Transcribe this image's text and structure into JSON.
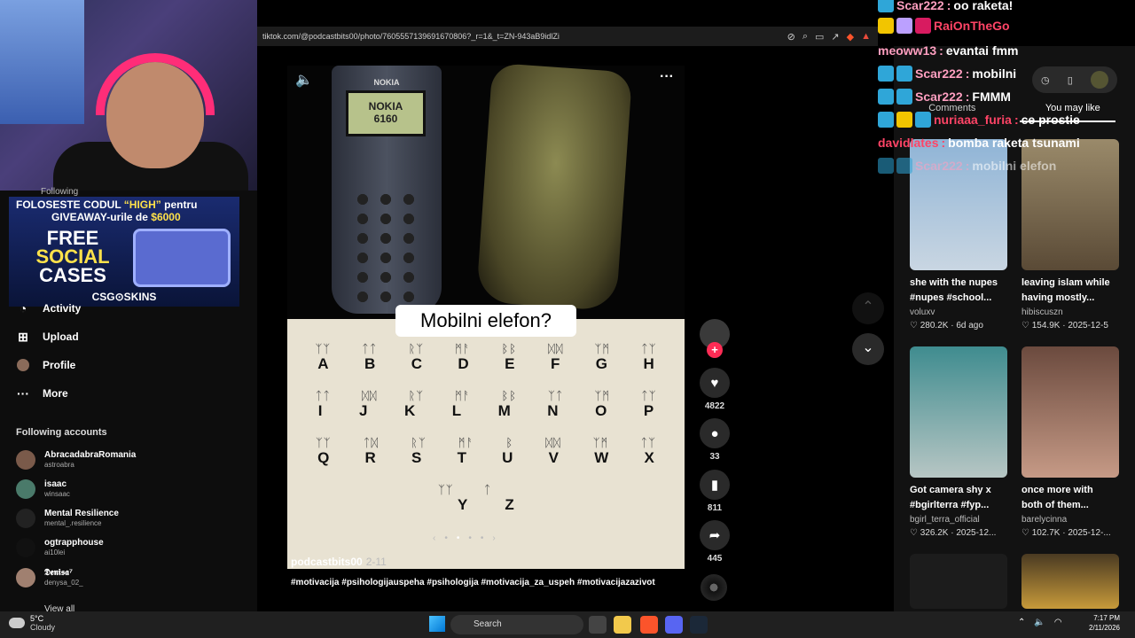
{
  "browser": {
    "url": "tiktok.com/@podcastbits00/photo/7605557139691670806?_r=1&_t=ZN-943aB9idlZi"
  },
  "promo": {
    "line1_a": "FOLOSESTE CODUL ",
    "line1_code": "“HIGH”",
    "line1_b": " pentru",
    "line2_a": "GIVEAWAY-urile de ",
    "line2_amount": "$6000",
    "free_word": "FREE",
    "social_word": "SOCIAL",
    "cases_word": "CASES",
    "brand": "CSG⊙SKINS"
  },
  "sidebar": {
    "following_label": "Following",
    "nav": [
      {
        "label": "Activity",
        "icon": "bell-icon"
      },
      {
        "label": "Upload",
        "icon": "upload-icon"
      },
      {
        "label": "Profile",
        "icon": "profile-icon"
      },
      {
        "label": "More",
        "icon": "more-dots-icon"
      }
    ],
    "accounts_title": "Following accounts",
    "accounts": [
      {
        "name": "AbracadabraRomania",
        "handle": "astroabra"
      },
      {
        "name": "isaac",
        "handle": "winsaac"
      },
      {
        "name": "Mental Resilience",
        "handle": "mental_.resilience"
      },
      {
        "name": "ogtrapphouse",
        "handle": "ai10lei"
      },
      {
        "name": "𝕯𝖊𝖓𝖎𝖘𝖆⁷",
        "handle": "denysa_02_"
      }
    ],
    "view_all": "View all"
  },
  "post": {
    "nokia_brand": "NOKIA",
    "nokia_screen_line1": "NOKIA",
    "nokia_screen_line2": "6160",
    "caption_bubble": "Mobilni elefon?",
    "alphabet_rows": [
      [
        "A",
        "B",
        "C",
        "D",
        "E",
        "F",
        "G",
        "H"
      ],
      [
        "I",
        "J",
        "K",
        "L",
        "M",
        "N",
        "O",
        "P"
      ],
      [
        "Q",
        "R",
        "S",
        "T",
        "U",
        "V",
        "W",
        "X"
      ],
      [
        "Y",
        "Z"
      ]
    ],
    "author": "podcastbits00",
    "date": "2-11",
    "hashtags": "#motivacija #psihologijauspeha #psihologija #motivacija_za_uspeh #motivacijazazivot",
    "likes": "4822",
    "comments": "33",
    "saves": "811",
    "shares": "445"
  },
  "right_panel": {
    "tabs": [
      "Comments",
      "You may like"
    ],
    "cards": [
      {
        "title1": "she with the nupes",
        "title2": "#nupes #school...",
        "user": "voluxv",
        "likes": "280.2K",
        "date": "6d ago",
        "color": "#7aa6c9"
      },
      {
        "title1": "leaving islam while",
        "title2": "having mostly...",
        "user": "hibiscuszn",
        "likes": "154.9K",
        "date": "2025-12-5",
        "color": "#8a7a5e"
      },
      {
        "title1": "Got camera shy x",
        "title2": "#bgirlterra #fyp...",
        "user": "bgirl_terra_official",
        "likes": "326.2K",
        "date": "2025-12...",
        "color": "#3f8c8f"
      },
      {
        "title1": "once more with",
        "title2": "both of them...",
        "user": "barelycinna",
        "likes": "102.7K",
        "date": "2025-12-...",
        "color": "#8a6b5a"
      },
      {
        "title1": "",
        "title2": "",
        "user": "",
        "likes": "",
        "date": "",
        "color": "#1a1a1a"
      },
      {
        "title1": "",
        "title2": "",
        "user": "",
        "likes": "",
        "date": "",
        "color": "#c79a3a"
      }
    ]
  },
  "chat": [
    {
      "user": "Scar222",
      "msg": "oo raketa!",
      "badges": 1
    },
    {
      "user": "RaiOnTheGo",
      "msg": "",
      "badges": 3
    },
    {
      "user": "meoww13",
      "msg": "evantai fmm",
      "badges": 0
    },
    {
      "user": "Scar222",
      "msg": "mobilni",
      "badges": 2
    },
    {
      "user": "Scar222",
      "msg": "FMMM",
      "badges": 2
    },
    {
      "user": "nuriaaa_furia",
      "msg": "ce prostie",
      "badges": 3
    },
    {
      "user": "davidlates",
      "msg": "bomba raketa tsunami",
      "badges": 0
    },
    {
      "user": "Scar222",
      "msg": "mobilni elefon",
      "badges": 2
    }
  ],
  "taskbar": {
    "temp": "5°C",
    "condition": "Cloudy",
    "search": "Search",
    "time": "7:17 PM",
    "date": "2/11/2026"
  }
}
